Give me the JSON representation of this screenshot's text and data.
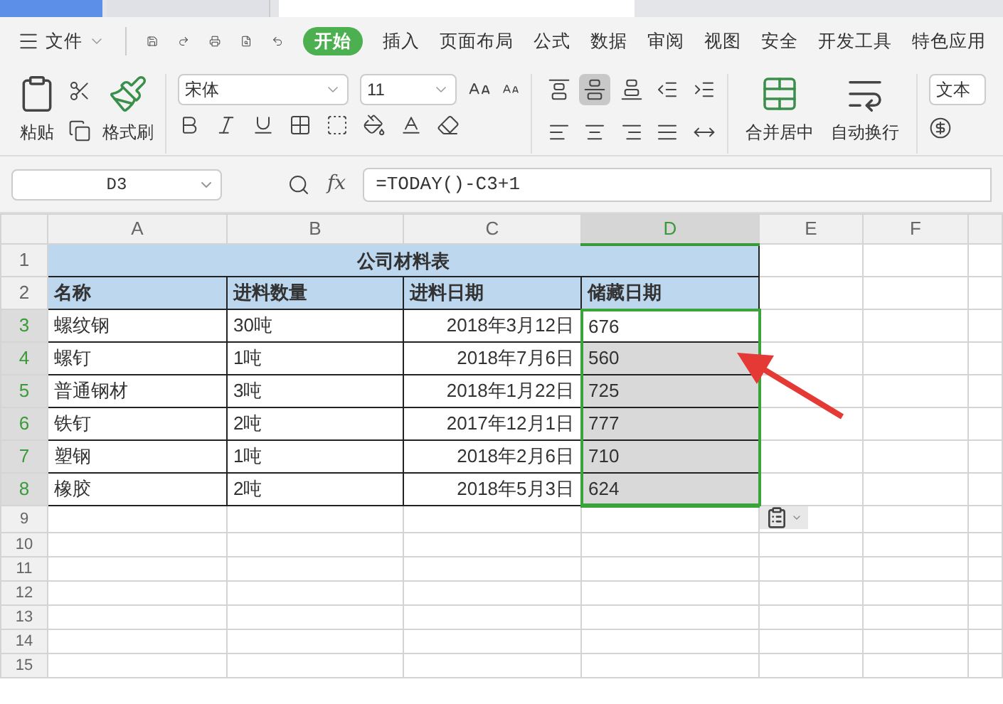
{
  "menu": {
    "file": "文件",
    "tabs": [
      {
        "label": "开始",
        "selected": true
      },
      {
        "label": "插入",
        "selected": false
      },
      {
        "label": "页面布局",
        "selected": false
      },
      {
        "label": "公式",
        "selected": false
      },
      {
        "label": "数据",
        "selected": false
      },
      {
        "label": "审阅",
        "selected": false
      },
      {
        "label": "视图",
        "selected": false
      },
      {
        "label": "安全",
        "selected": false
      },
      {
        "label": "开发工具",
        "selected": false
      },
      {
        "label": "特色应用",
        "selected": false
      }
    ]
  },
  "ribbon": {
    "paste": "粘贴",
    "format_painter": "格式刷",
    "font": "宋体",
    "size": "11",
    "align_buttons": [
      {
        "selected": false
      },
      {
        "selected": true
      },
      {
        "selected": false
      },
      {
        "selected": false
      },
      {
        "selected": false
      },
      {
        "selected": false
      },
      {
        "selected": false
      },
      {
        "selected": false
      },
      {
        "selected": false
      },
      {
        "selected": false
      }
    ],
    "merge": "合并居中",
    "wrap": "自动换行",
    "number_format": "文本"
  },
  "formula_bar": {
    "name_box": "D3",
    "fx": "fx",
    "formula": "=TODAY()-C3+1"
  },
  "sheet": {
    "columns": [
      {
        "label": "A",
        "selected": false
      },
      {
        "label": "B",
        "selected": false
      },
      {
        "label": "C",
        "selected": false
      },
      {
        "label": "D",
        "selected": true
      },
      {
        "label": "E",
        "selected": false
      },
      {
        "label": "F",
        "selected": false
      }
    ],
    "title": "公司材料表",
    "headers": [
      "名称",
      "进料数量",
      "进料日期",
      "储藏日期"
    ],
    "rows": [
      {
        "num": "3",
        "selected": true,
        "cells": [
          {
            "text": "螺纹钢"
          },
          {
            "text": "30吨"
          },
          {
            "text": "2018年3月12日"
          },
          {
            "text": "676",
            "selected": true,
            "active": true
          }
        ]
      },
      {
        "num": "4",
        "selected": true,
        "cells": [
          {
            "text": "螺钉"
          },
          {
            "text": "1吨"
          },
          {
            "text": "2018年7月6日"
          },
          {
            "text": "560",
            "selected": true,
            "active": false
          }
        ]
      },
      {
        "num": "5",
        "selected": true,
        "cells": [
          {
            "text": "普通钢材"
          },
          {
            "text": "3吨"
          },
          {
            "text": "2018年1月22日"
          },
          {
            "text": "725",
            "selected": true,
            "active": false
          }
        ]
      },
      {
        "num": "6",
        "selected": true,
        "cells": [
          {
            "text": "铁钉"
          },
          {
            "text": "2吨"
          },
          {
            "text": "2017年12月1日"
          },
          {
            "text": "777",
            "selected": true,
            "active": false
          }
        ]
      },
      {
        "num": "7",
        "selected": true,
        "cells": [
          {
            "text": "塑钢"
          },
          {
            "text": "1吨"
          },
          {
            "text": "2018年2月6日"
          },
          {
            "text": "710",
            "selected": true,
            "active": false
          }
        ]
      },
      {
        "num": "8",
        "selected": true,
        "cells": [
          {
            "text": "橡胶"
          },
          {
            "text": "2吨"
          },
          {
            "text": "2018年5月3日"
          },
          {
            "text": "624",
            "selected": true,
            "active": false
          }
        ]
      }
    ],
    "title_row": "1",
    "header_row": "2",
    "empty_rows": [
      "9",
      "10",
      "11",
      "12",
      "13",
      "14",
      "15"
    ]
  }
}
